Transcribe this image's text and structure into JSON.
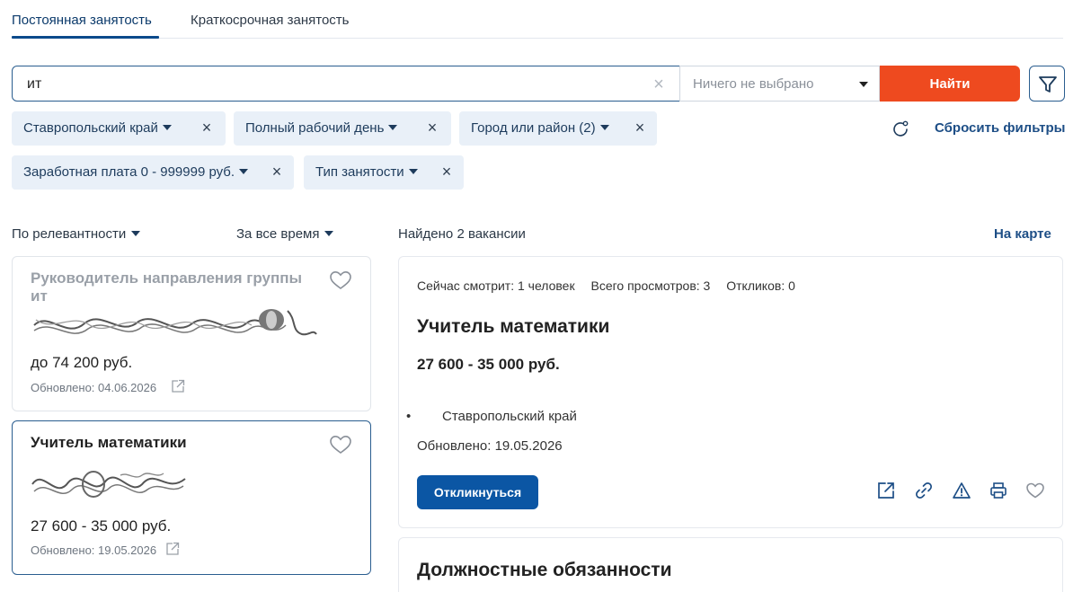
{
  "tabs": [
    {
      "label": "Постоянная занятость",
      "active": true
    },
    {
      "label": "Краткосрочная занятость",
      "active": false
    }
  ],
  "search": {
    "value": "ит",
    "select_placeholder": "Ничего не выбрано",
    "find_label": "Найти"
  },
  "filters": [
    {
      "label": "Ставропольский край"
    },
    {
      "label": "Полный рабочий день"
    },
    {
      "label": "Город или район (2)"
    },
    {
      "label": "Заработная плата 0 - 999999 руб."
    },
    {
      "label": "Тип занятости"
    }
  ],
  "reset_filters_label": "Сбросить фильтры",
  "sorting": {
    "relevance": "По релевантности",
    "period": "За все время"
  },
  "results": {
    "found_text": "Найдено 2 вакансии",
    "map_label": "На карте"
  },
  "cards": [
    {
      "title": "Руководитель направления группы ит",
      "salary": "до 74 200 руб.",
      "updated": "Обновлено: 04.06.2026",
      "selected": false
    },
    {
      "title": "Учитель математики",
      "salary": "27 600 - 35 000 руб.",
      "updated": "Обновлено: 19.05.2026",
      "selected": true
    }
  ],
  "detail": {
    "viewing_now": "Сейчас смотрит: 1 человек",
    "total_views": "Всего просмотров: 3",
    "responses": "Откликов: 0",
    "title": "Учитель математики",
    "salary": "27 600 - 35 000 руб.",
    "location": "Ставропольский край",
    "updated": "Обновлено: 19.05.2026",
    "apply_label": "Откликнуться"
  },
  "duties": {
    "title": "Должностные обязанности"
  },
  "colors": {
    "accent_blue": "#0b56a4",
    "find_orange": "#ee4a1f",
    "chip_bg": "#e9f0f8"
  }
}
